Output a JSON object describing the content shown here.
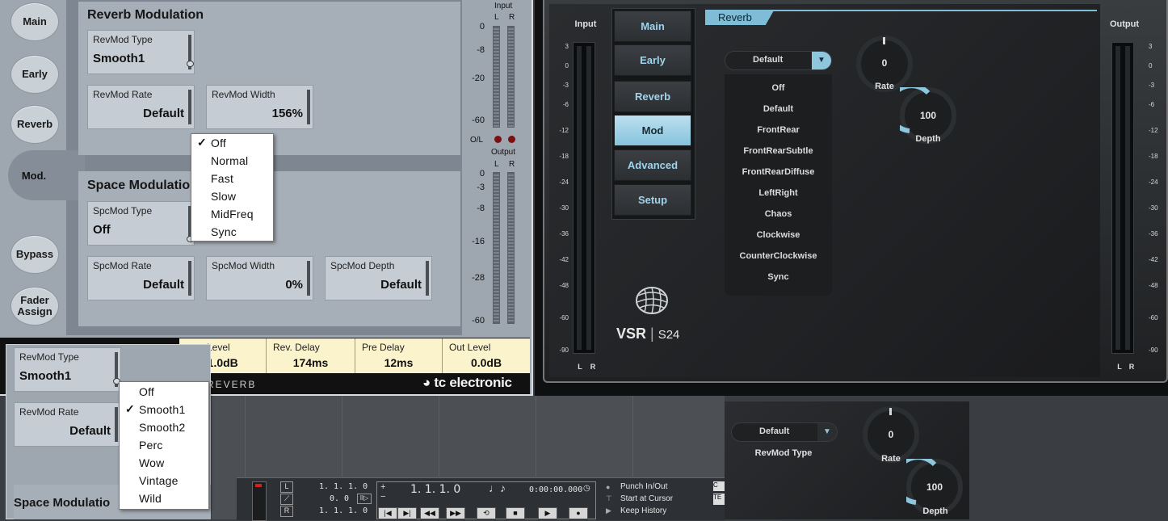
{
  "tc": {
    "side": {
      "main": "Main",
      "early": "Early",
      "reverb": "Reverb",
      "mod": "Mod.",
      "bypass": "Bypass",
      "fader1": "Fader",
      "fader2": "Assign"
    },
    "reverb_mod": {
      "title": "Reverb Modulation",
      "type_label": "RevMod Type",
      "type_value": "Smooth1",
      "rate_label": "RevMod Rate",
      "rate_value": "Default",
      "width_label": "RevMod Width",
      "width_value": "156%"
    },
    "space_mod": {
      "title": "Space Modulatio",
      "type_label": "SpcMod Type",
      "type_value": "Off",
      "rate_label": "SpcMod Rate",
      "rate_value": "Default",
      "width_label": "SpcMod Width",
      "width_value": "0%",
      "depth_label": "SpcMod Depth",
      "depth_value": "Default"
    },
    "meters": {
      "input_title": "Input",
      "output_title": "Output",
      "l": "L",
      "r": "R",
      "ol": "O/L",
      "input_ticks": [
        "0",
        "-8",
        "-20",
        "-60"
      ],
      "output_ticks": [
        "0",
        "-3",
        "-8",
        "-16",
        "-28",
        "-60"
      ]
    },
    "bottom": {
      "level_label": "Level",
      "level_value": "-1.0dB",
      "revdelay_label": "Rev. Delay",
      "revdelay_value": "174ms",
      "predelay_label": "Pre Delay",
      "predelay_value": "12ms",
      "outlevel_label": "Out Level",
      "outlevel_value": "0.0dB",
      "product": "REVERB",
      "brand": "tc electronic"
    },
    "spcmod_popup": {
      "items": [
        "Off",
        "Normal",
        "Fast",
        "Slow",
        "MidFreq",
        "Sync"
      ],
      "checked": "Off"
    }
  },
  "mini": {
    "type_label": "RevMod Type",
    "type_value": "Smooth1",
    "rate_label": "RevMod Rate",
    "rate_value": "Default",
    "space_title": "Space Modulatio",
    "popup": {
      "items": [
        "Off",
        "Smooth1",
        "Smooth2",
        "Perc",
        "Wow",
        "Vintage",
        "Wild"
      ],
      "checked": "Smooth1"
    }
  },
  "vsr": {
    "input": "Input",
    "output": "Output",
    "l": "L",
    "r": "R",
    "ticks": [
      "3",
      "0",
      "-3",
      "-6",
      "-12",
      "-18",
      "-24",
      "-30",
      "-36",
      "-42",
      "-48",
      "-60",
      "-90"
    ],
    "nav": [
      "Main",
      "Early",
      "Reverb",
      "Mod",
      "Advanced",
      "Setup"
    ],
    "active_nav": "Mod",
    "tab": "Reverb",
    "dropdown_value": "Default",
    "list": [
      "Off",
      "Default",
      "FrontRear",
      "FrontRearSubtle",
      "FrontRearDiffuse",
      "LeftRight",
      "Chaos",
      "Clockwise",
      "CounterClockwise",
      "Sync"
    ],
    "rate_value": "0",
    "rate_label": "Rate",
    "depth_value": "100",
    "depth_label": "Depth",
    "logo": "VSR",
    "logo_model": "S24"
  },
  "vsr_mini": {
    "dropdown_value": "Default",
    "type_label": "RevMod Type",
    "rate_value": "0",
    "rate_label": "Rate",
    "depth_value": "100",
    "depth_label": "Depth"
  },
  "transport": {
    "pos1": "1. 1. 1.   0",
    "pos2": "0.   0",
    "pos3": "1. 1. 1.   0",
    "main_pos": "1. 1. 1.   0",
    "time": "0:00:00.000",
    "punch": "Punch In/Out",
    "start": "Start at Cursor",
    "keep": "Keep History",
    "r_label": "R",
    "te_label": "TE",
    "c_label": "C"
  }
}
